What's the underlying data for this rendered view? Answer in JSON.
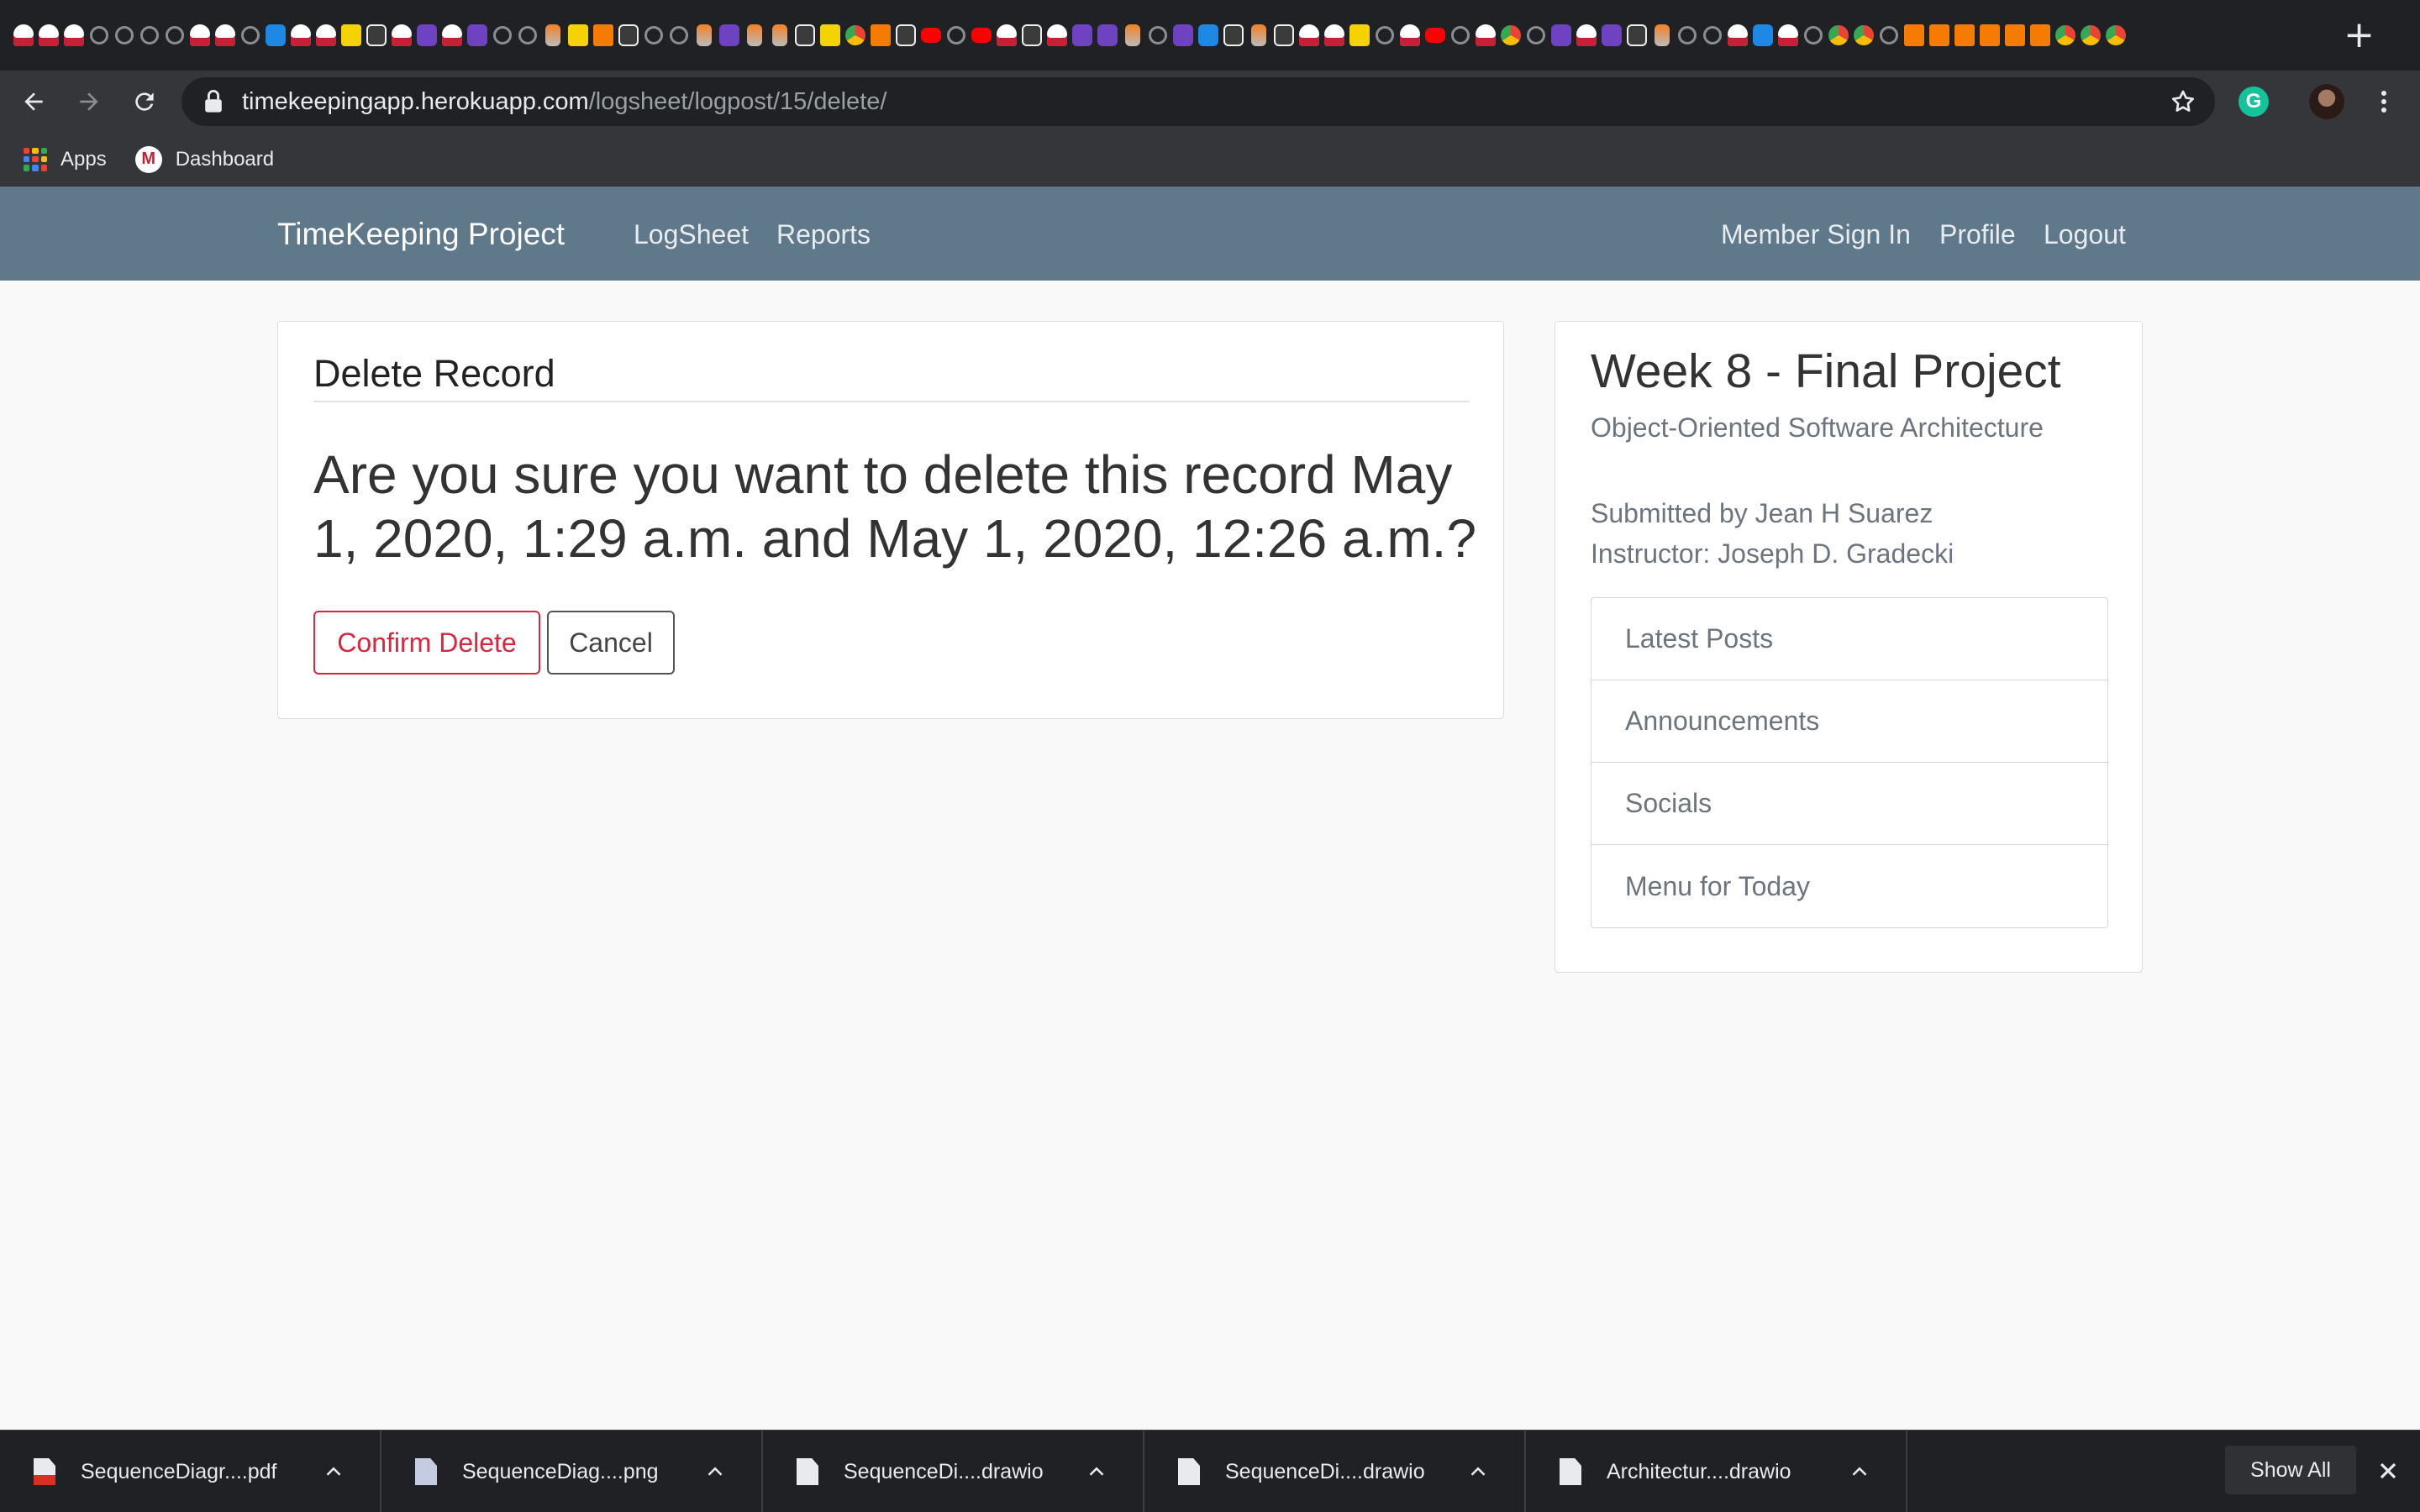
{
  "browser": {
    "url_host": "timekeepingapp.herokuapp.com",
    "url_path": "/logsheet/logpost/15/delete/",
    "new_tab_symbol": "+",
    "extension_letter": "G",
    "bookmarks": [
      {
        "label": "Apps",
        "icon": "apps-grid-icon"
      },
      {
        "label": "Dashboard",
        "icon": "dashboard-icon",
        "icon_letter": "M"
      }
    ],
    "tab_favicons": [
      "w",
      "w",
      "w",
      "g",
      "g",
      "g",
      "g",
      "w",
      "w",
      "g",
      "b",
      "w",
      "w",
      "y",
      "k",
      "w",
      "p",
      "w",
      "p",
      "g",
      "g",
      "o",
      "y",
      "a",
      "k",
      "g",
      "g",
      "o",
      "p",
      "o",
      "o",
      "k",
      "y",
      "c",
      "a",
      "k",
      "r",
      "g",
      "r",
      "w",
      "k",
      "w",
      "p",
      "p",
      "o",
      "g",
      "p",
      "b",
      "k",
      "o",
      "k",
      "w",
      "w",
      "y",
      "g",
      "w",
      "r",
      "g",
      "w",
      "c",
      "g",
      "p",
      "w",
      "p",
      "k",
      "o",
      "g",
      "g",
      "w",
      "b",
      "w",
      "g",
      "c",
      "c",
      "g",
      "a",
      "a",
      "a",
      "a",
      "a",
      "a",
      "c",
      "c",
      "c"
    ]
  },
  "site": {
    "brand": "TimeKeeping Project",
    "nav_left": [
      "LogSheet",
      "Reports"
    ],
    "nav_right": [
      "Member Sign In",
      "Profile",
      "Logout"
    ]
  },
  "delete_card": {
    "title": "Delete Record",
    "question": "Are you sure you want to delete this record May 1, 2020, 1:29 a.m. and May 1, 2020, 12:26 a.m.?",
    "confirm_label": "Confirm Delete",
    "cancel_label": "Cancel"
  },
  "sidebar": {
    "title": "Week 8 - Final Project",
    "course": "Object-Oriented Software Architecture",
    "submitted_by": "Submitted by Jean H Suarez",
    "instructor": "Instructor: Joseph D. Gradecki",
    "links": [
      "Latest Posts",
      "Announcements",
      "Socials",
      "Menu for Today"
    ]
  },
  "downloads": {
    "items": [
      {
        "name": "SequenceDiagr....pdf",
        "type": "pdf"
      },
      {
        "name": "SequenceDiag....png",
        "type": "png"
      },
      {
        "name": "SequenceDi....drawio",
        "type": "file"
      },
      {
        "name": "SequenceDi....drawio",
        "type": "file"
      },
      {
        "name": "Architectur....drawio",
        "type": "file"
      }
    ],
    "show_all_label": "Show All"
  },
  "colors": {
    "navbar": "#5f788a",
    "danger": "#d9263f",
    "page_bg": "#f9f9f9",
    "chrome_dark": "#202124",
    "chrome_toolbar": "#35363a"
  }
}
